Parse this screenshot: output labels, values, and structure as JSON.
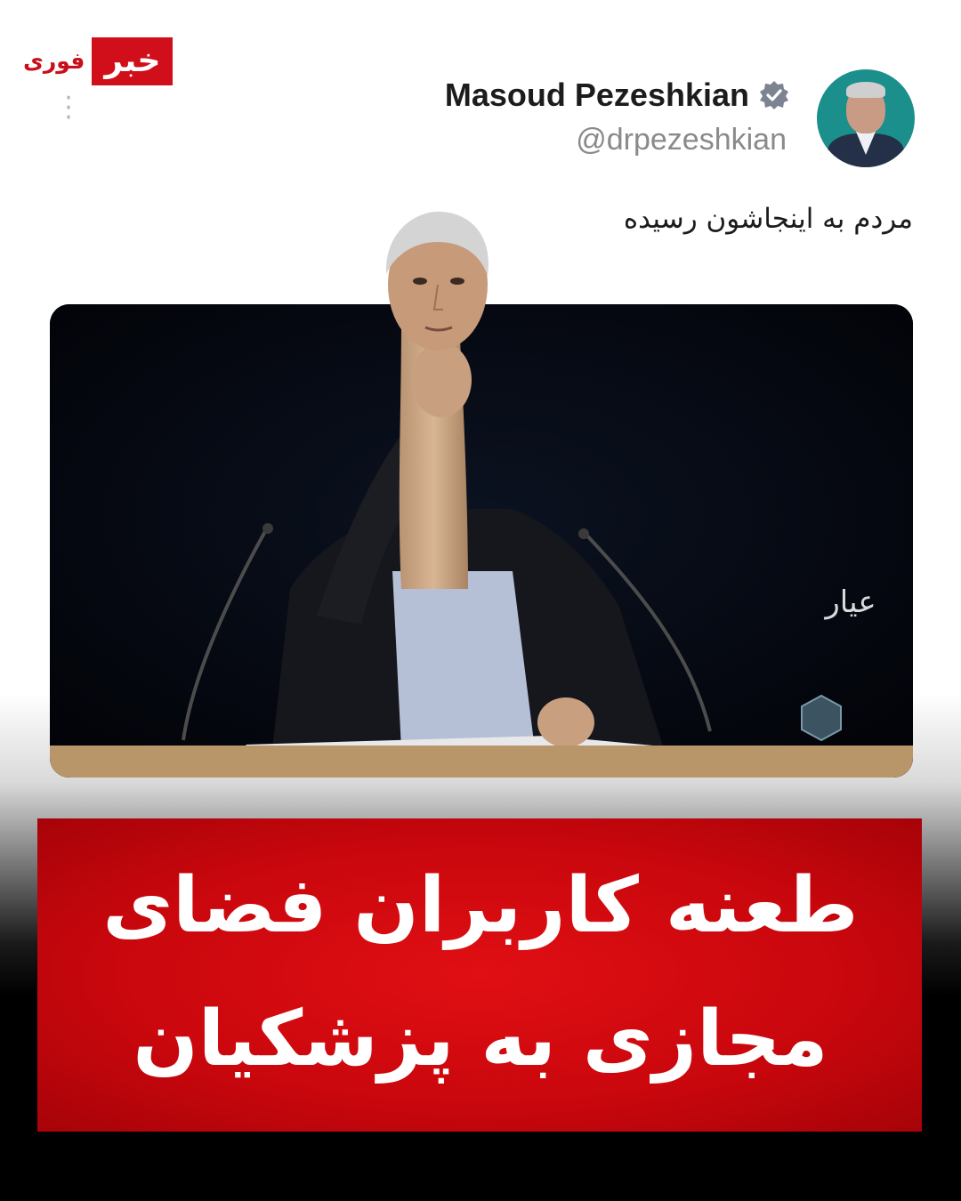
{
  "brand": {
    "badge_primary": "خبر",
    "badge_secondary": "فوری"
  },
  "tweet": {
    "display_name": "Masoud Pezeshkian",
    "handle": "@drpezeshkian",
    "verified": true,
    "text": "مردم به اینجاشون رسیده"
  },
  "media": {
    "watermark_text": "عیار"
  },
  "headline": {
    "line1": "طعنه کاربران فضای",
    "line2": "مجازی به پزشکیان"
  },
  "colors": {
    "badge_red": "#d10f1a",
    "headline_red": "#c8070d",
    "verified_gray": "#7b8490"
  }
}
